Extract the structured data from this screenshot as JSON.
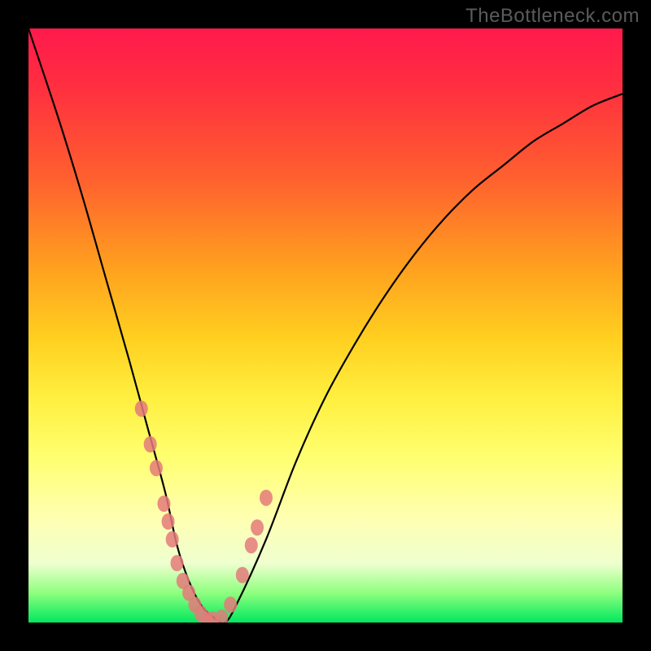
{
  "watermark": "TheBottleneck.com",
  "chart_data": {
    "type": "line",
    "title": "",
    "xlabel": "",
    "ylabel": "",
    "xlim": [
      0,
      100
    ],
    "ylim": [
      0,
      100
    ],
    "grid": false,
    "legend": false,
    "series": [
      {
        "name": "bottleneck-curve",
        "x": [
          0,
          5,
          9,
          13,
          17,
          20,
          23,
          25,
          27,
          29,
          31,
          33,
          35,
          40,
          45,
          50,
          55,
          60,
          65,
          70,
          75,
          80,
          85,
          90,
          95,
          100
        ],
        "values": [
          100,
          85,
          72,
          58,
          44,
          33,
          22,
          13,
          7,
          3,
          1,
          0,
          3,
          14,
          27,
          38,
          47,
          55,
          62,
          68,
          73,
          77,
          81,
          84,
          87,
          89
        ]
      }
    ],
    "markers": {
      "name": "sample-points",
      "x": [
        19,
        20.5,
        21.5,
        22.8,
        23.5,
        24.2,
        25,
        26,
        27,
        28,
        29,
        30,
        31,
        32.5,
        34,
        36,
        37.5,
        38.5,
        40
      ],
      "values": [
        36,
        30,
        26,
        20,
        17,
        14,
        10,
        7,
        5,
        3,
        1.5,
        0.5,
        0.5,
        0.8,
        3,
        8,
        13,
        16,
        21
      ]
    },
    "background_gradient": {
      "top": "#ff1a4d",
      "mid": "#ffff6f",
      "bottom": "#00e85f"
    }
  }
}
